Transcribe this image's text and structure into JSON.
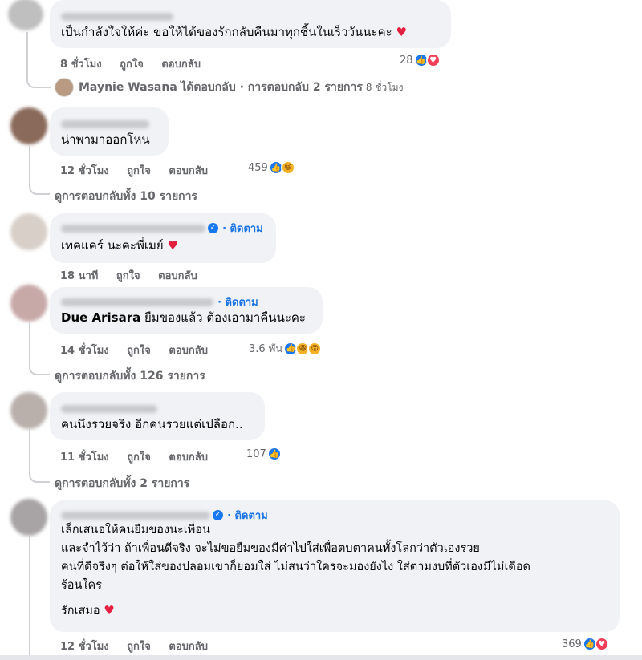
{
  "comments": [
    {
      "text": "เป็นกำลังใจให้ค่ะ ขอให้ได้ของรักกลับคืนมาทุกชิ้นในเร็ววันนะคะ",
      "time": "8 ชั่วโมง",
      "like": "ถูกใจ",
      "reply": "ตอบกลับ",
      "count": "28",
      "reply_preview": {
        "name": "Maynie Wasana",
        "label": "ได้ตอบกลับ · การตอบกลับ 2 รายการ",
        "time": "8 ชั่วโมง"
      }
    },
    {
      "text": "น่าพามาออกโหน",
      "time": "12 ชั่วโมง",
      "like": "ถูกใจ",
      "reply": "ตอบกลับ",
      "count": "459",
      "more": "ดูการตอบกลับทั้ง 10 รายการ"
    },
    {
      "follow": "· ติดตาม",
      "text": "เทคแคร์ นะคะพี่เมย์",
      "time": "18 นาที",
      "like": "ถูกใจ",
      "reply": "ตอบกลับ"
    },
    {
      "follow": "· ติดตาม",
      "text_name": "Due Arisara",
      "text": " ยืมของแล้ว ต้องเอามาคืนนะคะ",
      "time": "14 ชั่วโมง",
      "like": "ถูกใจ",
      "reply": "ตอบกลับ",
      "count": "3.6 พัน",
      "more": "ดูการตอบกลับทั้ง 126 รายการ"
    },
    {
      "text": "คนนึงรวยจริง อีกคนรวยแต่เปลือก..",
      "time": "11 ชั่วโมง",
      "like": "ถูกใจ",
      "reply": "ตอบกลับ",
      "count": "107",
      "more": "ดูการตอบกลับทั้ง 2 รายการ"
    },
    {
      "follow": "· ติดตาม",
      "lines": [
        "เล็กเสนอให้คนยืมของนะเพื่อน",
        "และจำไว้ว่า ถ้าเพื่อนดีจริง จะไม่ขอยืมของมีค่าไปใส่เพื่อตบตาคนทั้งโลกว่าตัวเองรวย",
        "คนที่ดีจริงๆ ต่อให้ใส่ของปลอมเขาก็ยอมใส่ ไม่สนว่าใครจะมองยังไง ใส่ตามงบที่ตัวเองมีไม่เดือด",
        "ร้อนใคร"
      ],
      "last": "รักเสมอ",
      "time": "12 ชั่วโมง",
      "like": "ถูกใจ",
      "reply": "ตอบกลับ",
      "count": "369"
    }
  ],
  "icons": {
    "heart": "♥",
    "like": "👍",
    "haha": "😆",
    "wow": "😮",
    "verified": "✓"
  },
  "colors": {
    "bubble": "#f0f2f5",
    "secondary_text": "#65676b",
    "link": "#1b74e4",
    "like_blue": "#1877f2",
    "love_red": "#f33e58"
  }
}
